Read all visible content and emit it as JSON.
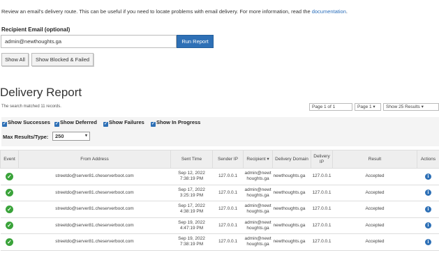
{
  "intro": {
    "text": "Review an email's delivery route. This can be useful if you need to locate problems with email delivery. For more information, read the ",
    "link": "documentation",
    "suffix": "."
  },
  "recipient": {
    "label": "Recipient Email (optional)",
    "value": "admin@newthoughts.ga",
    "run_button": "Run Report"
  },
  "buttons": {
    "show_all": "Show All",
    "show_blocked": "Show Blocked & Failed"
  },
  "report": {
    "title": "Delivery Report",
    "match_text": "The search matched 11 records.",
    "pager_page_of": "Page 1 of 1",
    "pager_page_select": "Page 1",
    "pager_results": "Show 25 Results"
  },
  "filters": {
    "successes": "Show Successes",
    "deferred": "Show Deferred",
    "failures": "Show Failures",
    "in_progress": "Show In Progress",
    "max_label": "Max Results/Type:",
    "max_value": "250"
  },
  "table": {
    "headers": {
      "event": "Event",
      "from": "From Address",
      "sent": "Sent Time",
      "sender_ip": "Sender IP",
      "recipient": "Recipient",
      "delivery_domain": "Delivery Domain",
      "delivery_ip": "Delivery IP",
      "result": "Result",
      "actions": "Actions"
    },
    "rows": [
      {
        "from": "streetdo@server81.cheserverboot.com",
        "date": "Sep 12, 2022",
        "time": "7:38:19 PM",
        "sender_ip": "127.0.0.1",
        "recipient": "admin@newthoughts.ga",
        "domain": "newthoughts.ga",
        "delivery_ip": "127.0.0.1",
        "result": "Accepted"
      },
      {
        "from": "streetdo@server81.cheserverboot.com",
        "date": "Sep 17, 2022",
        "time": "3:25:19 PM",
        "sender_ip": "127.0.0.1",
        "recipient": "admin@newthoughts.ga",
        "domain": "newthoughts.ga",
        "delivery_ip": "127.0.0.1",
        "result": "Accepted"
      },
      {
        "from": "streetdo@server81.cheserverboot.com",
        "date": "Sep 17, 2022",
        "time": "4:38:19 PM",
        "sender_ip": "127.0.0.1",
        "recipient": "admin@newthoughts.ga",
        "domain": "newthoughts.ga",
        "delivery_ip": "127.0.0.1",
        "result": "Accepted"
      },
      {
        "from": "streetdo@server81.cheserverboot.com",
        "date": "Sep 19, 2022",
        "time": "4:47:19 PM",
        "sender_ip": "127.0.0.1",
        "recipient": "admin@newthoughts.ga",
        "domain": "newthoughts.ga",
        "delivery_ip": "127.0.0.1",
        "result": "Accepted"
      },
      {
        "from": "streetdo@server81.cheserverboot.com",
        "date": "Sep 19, 2022",
        "time": "7:38:19 PM",
        "sender_ip": "127.0.0.1",
        "recipient": "admin@newthoughts.ga",
        "domain": "newthoughts.ga",
        "delivery_ip": "127.0.0.1",
        "result": "Accepted"
      }
    ]
  }
}
